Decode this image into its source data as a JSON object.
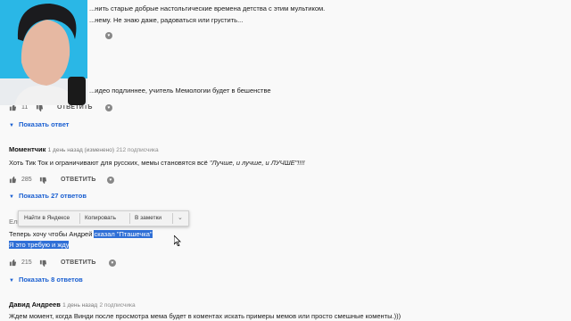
{
  "thread": {
    "line1": "...нить старые добрые настольгические времена детства с этим мультиком.",
    "line2": "...нему. Не знаю даже, радоваться или грустить...",
    "line3": "...идео подлиннее, учитель Мемологии будет в бешенстве",
    "likes": "11",
    "reply": "ОТВЕТИТЬ",
    "show_reply": "Показать ответ"
  },
  "comment2": {
    "author": "Моментчик",
    "meta": "1 день назад (изменено)",
    "subs": "212 подписчика",
    "text_plain": "Хоть Тик Ток и ограничивают для русских, мемы становятся всё ",
    "text_italic": "\"Лучше, и лучше, и ЛУЧШЕ\"!!!!",
    "likes": "285",
    "reply": "ОТВЕТИТЬ",
    "show_replies": "Показать 27 ответов"
  },
  "context_menu": {
    "find": "Найти в Яндексе",
    "copy": "Копировать",
    "notes": "В заметки"
  },
  "comment3": {
    "author_partial": "Ел",
    "text_before": "Теперь хочу чтобы Андрей ",
    "text_selected": "сказал \"Пташечка\"",
    "text_line2": "Я это требую и жду",
    "likes": "215",
    "reply": "ОТВЕТИТЬ",
    "show_replies": "Показать 8 ответов"
  },
  "comment4": {
    "author": "Давид Андреев",
    "meta": "1 день назад",
    "subs": "2 подписчика",
    "text": "Ждем момент, когда Винди после просмотра мема будет в коментах искать примеры мемов или просто смешные коменты.)))"
  },
  "icons": [
    "thumb-up-icon",
    "thumb-down-icon",
    "heart-icon",
    "chevron-down-icon",
    "mouse-cursor-icon"
  ]
}
